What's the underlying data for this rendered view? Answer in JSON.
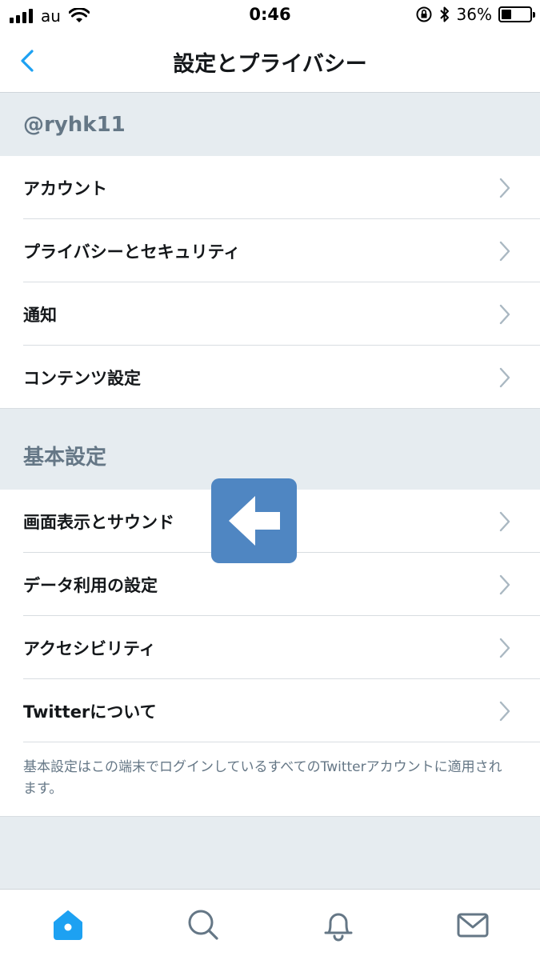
{
  "status_bar": {
    "carrier": "au",
    "time": "0:46",
    "battery_percent": "36%",
    "battery_level": 0.36
  },
  "nav": {
    "title": "設定とプライバシー",
    "back_icon": "chevron-left-icon"
  },
  "account_section": {
    "header": "@ryhk11",
    "items": [
      {
        "label": "アカウント"
      },
      {
        "label": "プライバシーとセキュリティ"
      },
      {
        "label": "通知"
      },
      {
        "label": "コンテンツ設定"
      }
    ]
  },
  "general_section": {
    "header": "基本設定",
    "items": [
      {
        "label": "画面表示とサウンド"
      },
      {
        "label": "データ利用の設定"
      },
      {
        "label": "アクセシビリティ"
      },
      {
        "label": "Twitterについて"
      }
    ],
    "footnote": "基本設定はこの端末でログインしているすべてのTwitterアカウントに適用されます。"
  },
  "overlay": {
    "icon": "left-arrow-icon",
    "color": "#4f86c2"
  },
  "tab_bar": {
    "tabs": [
      {
        "icon": "home-icon",
        "active": true
      },
      {
        "icon": "search-icon",
        "active": false
      },
      {
        "icon": "notifications-bell-icon",
        "active": false
      },
      {
        "icon": "messages-envelope-icon",
        "active": false
      }
    ]
  },
  "colors": {
    "accent": "#1da1f2",
    "section_bg": "#e6ecf0",
    "secondary_text": "#657786",
    "tab_inactive": "#657786"
  }
}
